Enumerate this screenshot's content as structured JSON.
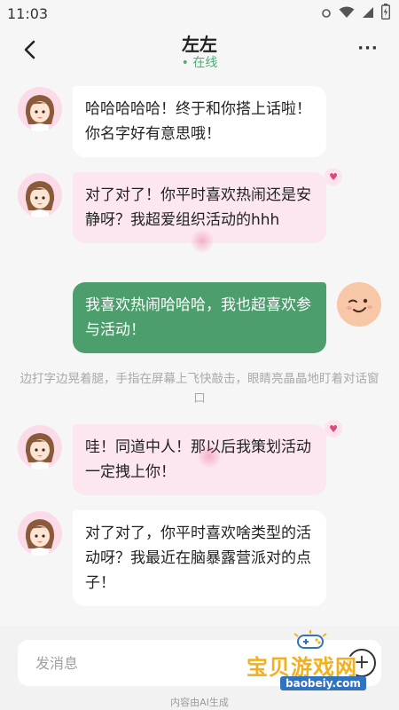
{
  "status_bar": {
    "time": "11:03"
  },
  "header": {
    "title": "左左",
    "status": "在线"
  },
  "messages": [
    {
      "sender": "ai",
      "text": "哈哈哈哈哈！终于和你搭上话啦！你名字好有意思哦！"
    },
    {
      "sender": "ai",
      "text": "对了对了！你平时喜欢热闹还是安静呀？我超爱组织活动的hhh",
      "liked": true
    },
    {
      "sender": "user",
      "text": "我喜欢热闹哈哈哈，我也超喜欢参与活动！"
    },
    {
      "sender": "ai",
      "text": "哇！同道中人！那以后我策划活动一定拽上你！",
      "liked": true
    },
    {
      "sender": "ai",
      "text": "对了对了，你平时喜欢啥类型的活动呀？我最近在脑暴露营派对的点子！"
    }
  ],
  "narration": "边打字边晃着腿，手指在屏幕上飞快敲击，眼睛亮晶晶地盯着对话窗口",
  "input": {
    "placeholder": "发消息"
  },
  "footer_note": "内容由AI生成",
  "watermark": {
    "title": "宝贝游戏网",
    "url": "baobeiy.com"
  },
  "colors": {
    "user_bubble": "#4c9e6c",
    "ai_bubble": "#ffffff",
    "ai_bubble_liked": "#fce7f1",
    "online": "#4cae75",
    "heart": "#e0457b"
  }
}
